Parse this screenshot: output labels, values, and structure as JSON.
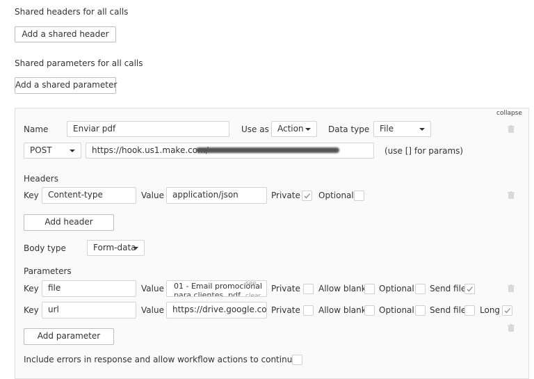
{
  "shared_headers": {
    "label": "Shared headers for all calls",
    "add_button": "Add a shared header"
  },
  "shared_params": {
    "label": "Shared parameters for all calls",
    "add_button": "Add a shared parameter"
  },
  "call": {
    "collapse": "collapse",
    "name_label": "Name",
    "name_value": "Enviar pdf",
    "use_as_label": "Use as",
    "use_as_value": "Action",
    "data_type_label": "Data type",
    "data_type_value": "File",
    "method": "POST",
    "url_value": "https://hook.us1.make.com/",
    "url_hint": "(use [] for params)",
    "headers_label": "Headers",
    "header_row": {
      "key_label": "Key",
      "key_value": "Content-type",
      "value_label": "Value",
      "value_value": "application/json",
      "private_label": "Private",
      "optional_label": "Optional"
    },
    "add_header_button": "Add header",
    "body_type_label": "Body type",
    "body_type_value": "Form-data",
    "parameters_label": "Parameters",
    "param_rows": [
      {
        "key_label": "Key",
        "key_value": "file",
        "value_label": "Value",
        "value_value_line1": "01 - Email promocional",
        "value_value_line2": "para clientes .pdf",
        "see_label": "see",
        "clear_label": "clear",
        "private_label": "Private",
        "allow_blank_label": "Allow blank",
        "optional_label": "Optional",
        "send_file_label": "Send file"
      },
      {
        "key_label": "Key",
        "key_value": "url",
        "value_label": "Value",
        "value_value": "https://drive.google.com/",
        "private_label": "Private",
        "allow_blank_label": "Allow blank",
        "optional_label": "Optional",
        "send_file_label": "Send file",
        "long_label": "Long"
      }
    ],
    "add_parameter_button": "Add parameter",
    "include_errors_label": "Include errors in response and allow workflow actions to continue"
  },
  "icons": {
    "checkmark": "check-icon",
    "trash": "trash-icon",
    "caret": "caret-down-icon"
  }
}
